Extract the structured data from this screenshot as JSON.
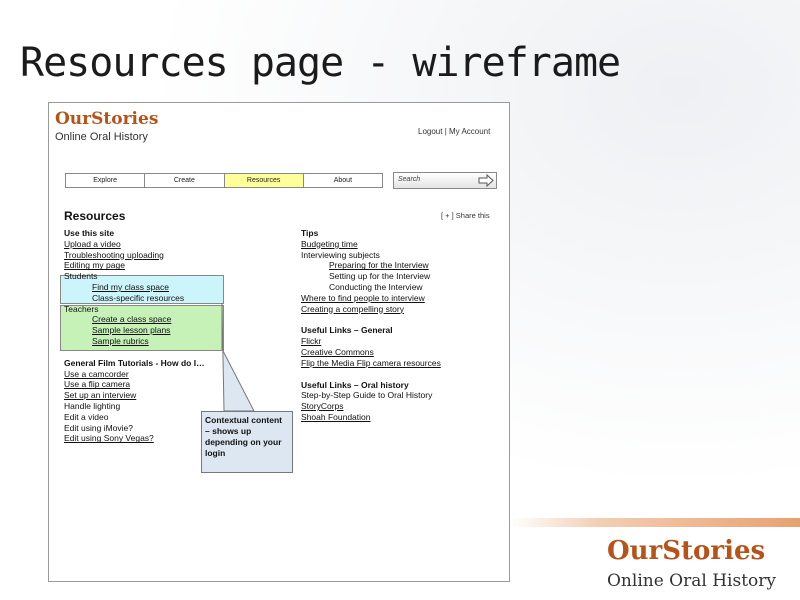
{
  "slide": {
    "title": "Resources page - wireframe"
  },
  "site": {
    "logo_title": "OurStories",
    "logo_subtitle": "Online Oral History",
    "account_links": "Logout | My Account"
  },
  "nav": {
    "items": [
      {
        "label": "Explore"
      },
      {
        "label": "Create"
      },
      {
        "label": "Resources",
        "active": true
      },
      {
        "label": "About"
      }
    ],
    "search_placeholder": "Search"
  },
  "resources": {
    "title": "Resources",
    "share_label": "[ + ] Share this"
  },
  "left_column": [
    {
      "text": "Use this site",
      "style": "h"
    },
    {
      "text": "Upload a video",
      "style": "lnk"
    },
    {
      "text": "Troubleshooting uploading",
      "style": "lnk"
    },
    {
      "text": "Editing my page",
      "style": "lnk"
    },
    {
      "text": "Students",
      "style": ""
    },
    {
      "text": "Find my class space",
      "style": "lnk ind"
    },
    {
      "text": "Class-specific resources",
      "style": "ind"
    },
    {
      "text": "Teachers",
      "style": ""
    },
    {
      "text": "Create a class space",
      "style": "lnk ind"
    },
    {
      "text": "Sample lesson plans",
      "style": "lnk ind"
    },
    {
      "text": "Sample rubrics",
      "style": "lnk ind"
    },
    {
      "text": "",
      "style": "gap"
    },
    {
      "text": "General Film Tutorials - How do I…",
      "style": "h"
    },
    {
      "text": "Use a camcorder",
      "style": "lnk"
    },
    {
      "text": "Use a flip camera",
      "style": "lnk"
    },
    {
      "text": "Set up an interview",
      "style": "lnk"
    },
    {
      "text": "Handle lighting",
      "style": ""
    },
    {
      "text": "Edit a video",
      "style": ""
    },
    {
      "text": "Edit using iMovie?",
      "style": ""
    },
    {
      "text": "Edit using Sony Vegas?",
      "style": "lnk"
    }
  ],
  "right_column": [
    {
      "text": "Tips",
      "style": "h"
    },
    {
      "text": "Budgeting time",
      "style": "lnk"
    },
    {
      "text": "Interviewing subjects",
      "style": ""
    },
    {
      "text": "Preparing for the Interview",
      "style": "lnk ind"
    },
    {
      "text": "Setting up for the Interview",
      "style": "ind"
    },
    {
      "text": "Conducting the Interview",
      "style": "ind"
    },
    {
      "text": "Where to find people to interview",
      "style": "lnk"
    },
    {
      "text": "Creating a compelling story",
      "style": "lnk"
    },
    {
      "text": "",
      "style": "gap"
    },
    {
      "text": "Useful Links – General",
      "style": "h"
    },
    {
      "text": "Flickr",
      "style": "lnk"
    },
    {
      "text": "Creative Commons",
      "style": "lnk"
    },
    {
      "text": "Flip the Media Flip camera resources",
      "style": "lnk"
    },
    {
      "text": "",
      "style": "gap"
    },
    {
      "text": "Useful Links – Oral history",
      "style": "h"
    },
    {
      "text": "Step-by-Step Guide to Oral History",
      "style": ""
    },
    {
      "text": "StoryCorps",
      "style": "lnk"
    },
    {
      "text": "Shoah Foundation",
      "style": "lnk"
    }
  ],
  "callout": {
    "text": "Contextual content – shows up depending on your login"
  },
  "brand_footer": {
    "title": "OurStories",
    "subtitle": "Online Oral History"
  },
  "colors": {
    "brand_orange": "#b5531a",
    "active_tab": "#ffff99",
    "students_highlight": "#ccf5fb",
    "teachers_highlight": "#c6f2b8",
    "callout_bg": "#dde7f2"
  },
  "icons": {
    "search_go": "arrow-right-icon"
  }
}
